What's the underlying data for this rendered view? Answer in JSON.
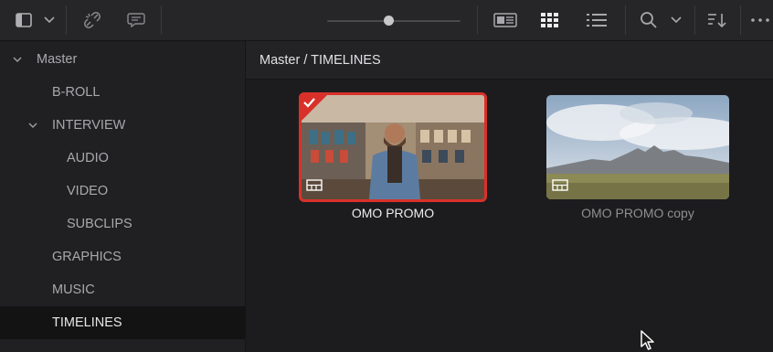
{
  "toolbar": {
    "icons": [
      "panel-layout-icon",
      "chevron-down-icon",
      "unlink-icon",
      "metadata-burst-icon",
      "clip-view-icon",
      "thumbnail-grid-icon",
      "list-view-icon",
      "search-icon",
      "chevron-down-icon",
      "sort-icon",
      "more-options-icon"
    ],
    "zoom_slider_fraction": 0.47
  },
  "sidebar": {
    "items": [
      {
        "label": "Master",
        "level": 0,
        "expanded": true
      },
      {
        "label": "B-ROLL",
        "level": 1
      },
      {
        "label": "INTERVIEW",
        "level": 1,
        "expanded": true
      },
      {
        "label": "AUDIO",
        "level": 2
      },
      {
        "label": "VIDEO",
        "level": 2
      },
      {
        "label": "SUBCLIPS",
        "level": 2
      },
      {
        "label": "GRAPHICS",
        "level": 1
      },
      {
        "label": "MUSIC",
        "level": 1
      },
      {
        "label": "TIMELINES",
        "level": 1,
        "selected": true
      }
    ]
  },
  "main": {
    "breadcrumb": "Master / TIMELINES",
    "clips": [
      {
        "title": "OMO PROMO",
        "selected": true,
        "badge": "timeline-icon",
        "checked": true
      },
      {
        "title": "OMO PROMO copy",
        "selected": false,
        "badge": "timeline-icon"
      }
    ]
  },
  "colors": {
    "selection_red": "#d9312a",
    "background": "#1b1b1d",
    "toolbar": "#262629",
    "text": "#e1e1e3",
    "muted_text": "#8f8f92"
  }
}
